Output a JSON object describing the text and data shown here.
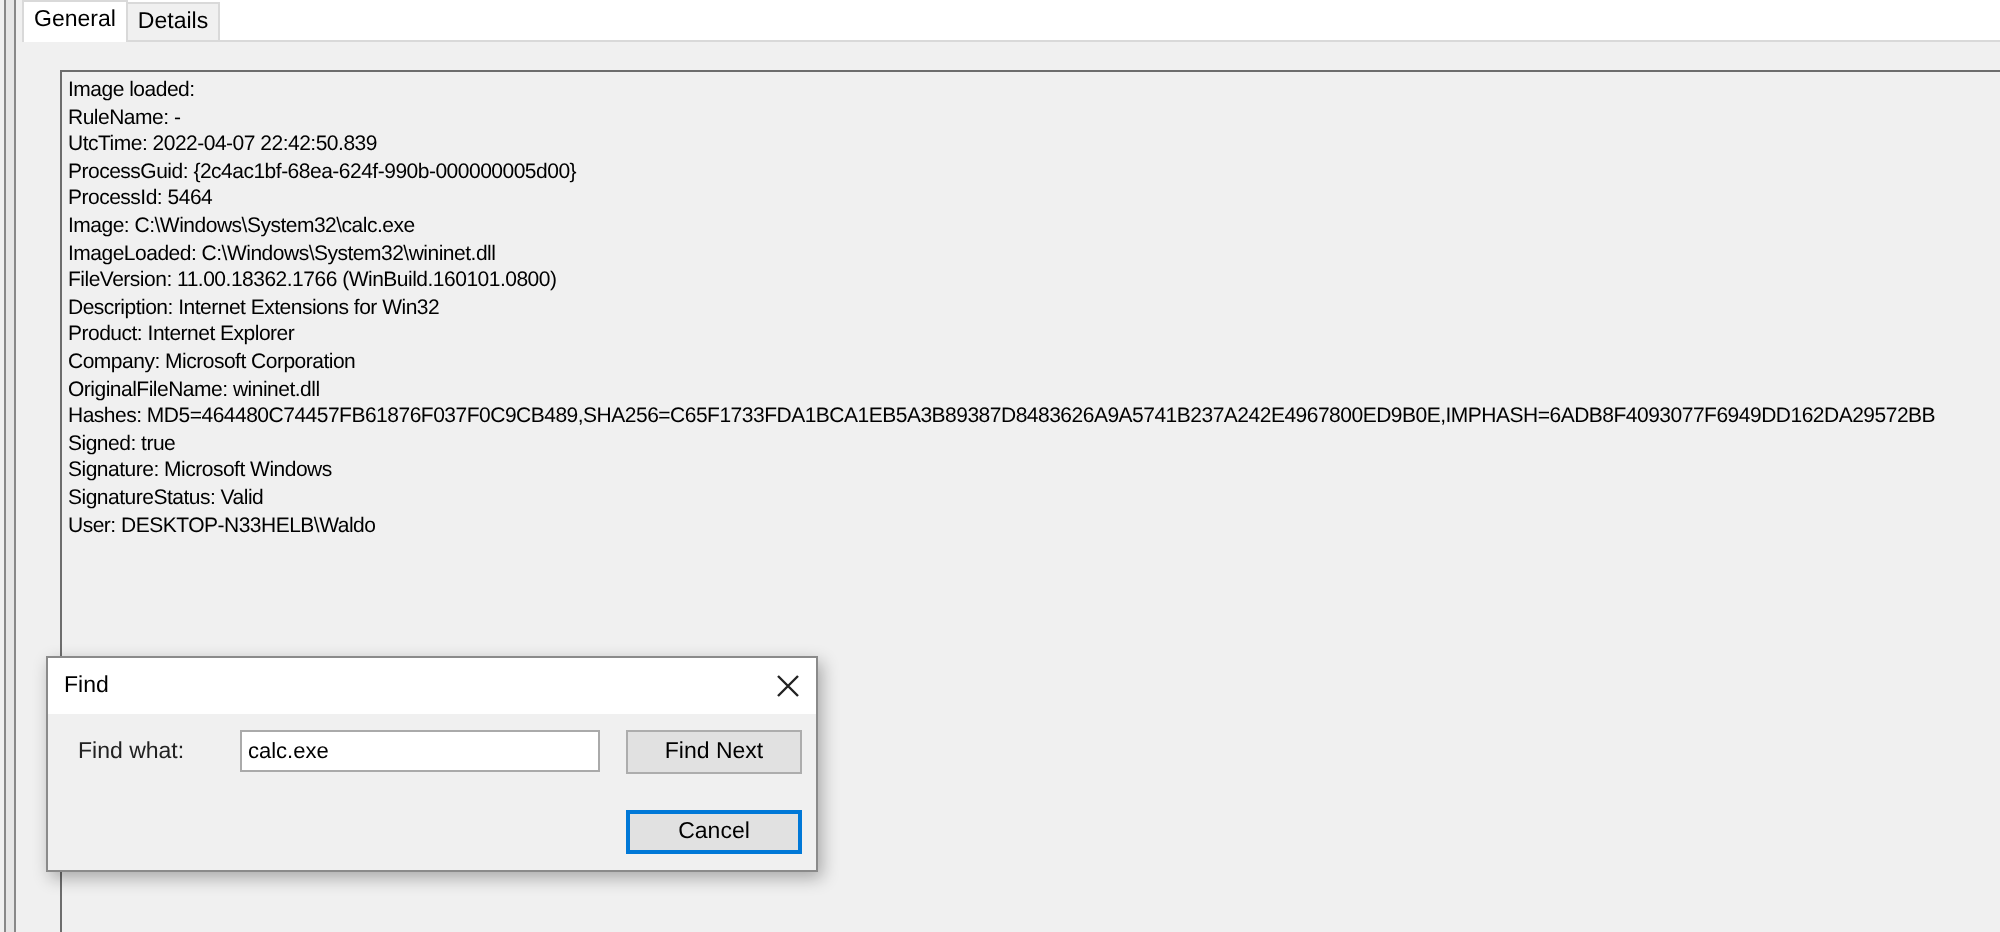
{
  "tabs": [
    {
      "label": "General",
      "selected": true
    },
    {
      "label": "Details",
      "selected": false
    }
  ],
  "event_lines": [
    "Image loaded:",
    "RuleName: -",
    "UtcTime: 2022-04-07 22:42:50.839",
    "ProcessGuid: {2c4ac1bf-68ea-624f-990b-000000005d00}",
    "ProcessId: 5464",
    "Image: C:\\Windows\\System32\\calc.exe",
    "ImageLoaded: C:\\Windows\\System32\\wininet.dll",
    "FileVersion: 11.00.18362.1766 (WinBuild.160101.0800)",
    "Description: Internet Extensions for Win32",
    "Product: Internet Explorer",
    "Company: Microsoft Corporation",
    "OriginalFileName: wininet.dll",
    "Hashes: MD5=464480C74457FB61876F037F0C9CB489,SHA256=C65F1733FDA1BCA1EB5A3B89387D8483626A9A5741B237A242E4967800ED9B0E,IMPHASH=6ADB8F4093077F6949DD162DA29572BB",
    "Signed: true",
    "Signature: Microsoft Windows",
    "SignatureStatus: Valid",
    "User: DESKTOP-N33HELB\\Waldo"
  ],
  "find_dialog": {
    "title": "Find",
    "label": "Find what:",
    "value": "calc.exe",
    "buttons": [
      {
        "label": "Find Next",
        "selected": false
      },
      {
        "label": "Cancel",
        "selected": true
      }
    ]
  }
}
